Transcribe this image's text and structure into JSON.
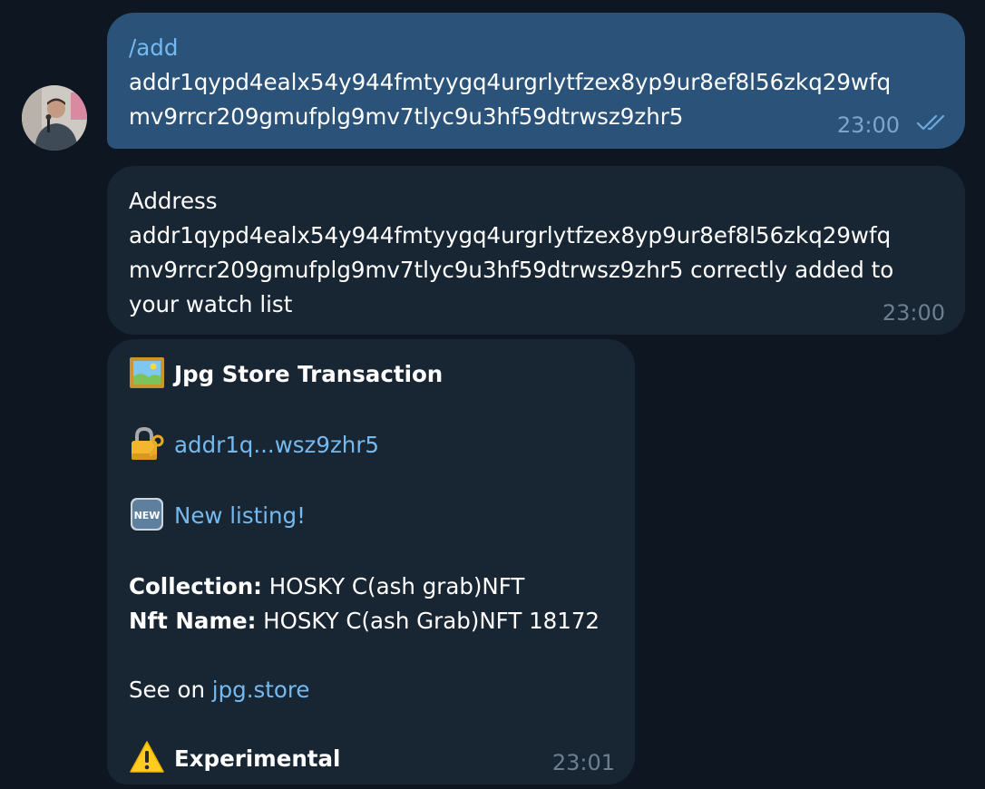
{
  "outgoing": {
    "command": "/add",
    "address_line1": "addr1qypd4ealx54y944fmtyygq4urgrlytfzex8yp9ur8ef8l56zkq29wfq",
    "address_line2": "mv9rrcr209gmufplg9mv7tlyc9u3hf59dtrwsz9zhr5",
    "time": "23:00",
    "status_icon": "double-check-icon"
  },
  "reply": {
    "line1": "Address",
    "line2": "addr1qypd4ealx54y944fmtyygq4urgrlytfzex8yp9ur8ef8l56zkq29wfq",
    "line3": "mv9rrcr209gmufplg9mv7tlyc9u3hf59dtrwsz9zhr5 correctly added to",
    "line4": "your watch list",
    "time": "23:00"
  },
  "notification": {
    "title_icon": "framed-picture-icon",
    "title": "Jpg Store Transaction",
    "address_icon": "locked-with-key-icon",
    "address_short": "addr1q...wsz9zhr5",
    "new_icon": "new-button-icon",
    "new_listing": "New listing!",
    "collection_label": "Collection:",
    "collection_value": " HOSKY C(ash grab)NFT",
    "nft_name_label": "Nft Name:",
    "nft_name_value": " HOSKY C(ash Grab)NFT 18172",
    "see_on_prefix": "See on ",
    "see_on_link": "jpg.store",
    "warning_icon": "warning-icon",
    "experimental": "Experimental",
    "time": "23:01"
  },
  "colors": {
    "background": "#0e1621",
    "outgoing_bubble": "#2b5278",
    "incoming_bubble": "#182533",
    "link": "#74b9ef"
  }
}
